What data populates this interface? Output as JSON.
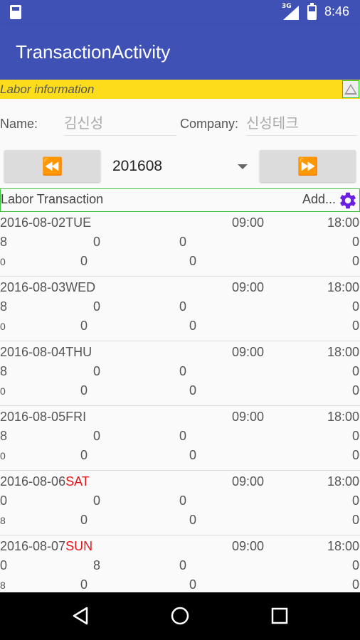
{
  "status_bar": {
    "network": "3G",
    "time": "8:46",
    "icons": [
      "sd-card-icon",
      "signal-icon",
      "battery-charging-icon"
    ]
  },
  "app_bar": {
    "title": "TransactionActivity"
  },
  "labor_info": {
    "section_label": "Labor information",
    "name_label": "Name:",
    "name_value": "김신성",
    "company_label": "Company:",
    "company_value": "신성테크"
  },
  "month_nav": {
    "prev_icon": "rewind-icon",
    "selected_month": "201608",
    "next_icon": "fast-forward-icon"
  },
  "labor_transaction": {
    "label": "Labor Transaction",
    "add_label": "Add...",
    "settings_icon": "gear-icon",
    "accent_color": "#6A1FE0"
  },
  "colors": {
    "primary": "#3F51B5",
    "section_bar": "#FDDC1B",
    "weekend": "#E8141A",
    "border_green": "#3BC23B"
  },
  "rows": [
    {
      "date": "2016-08-02",
      "dow": "TUE",
      "weekend": false,
      "start": "09:00",
      "end": "18:00",
      "l2": [
        "8",
        "0",
        "0",
        "0"
      ],
      "l3": [
        "0",
        "0",
        "0",
        "0"
      ]
    },
    {
      "date": "2016-08-03",
      "dow": "WED",
      "weekend": false,
      "start": "09:00",
      "end": "18:00",
      "l2": [
        "8",
        "0",
        "0",
        "0"
      ],
      "l3": [
        "0",
        "0",
        "0",
        "0"
      ]
    },
    {
      "date": "2016-08-04",
      "dow": "THU",
      "weekend": false,
      "start": "09:00",
      "end": "18:00",
      "l2": [
        "8",
        "0",
        "0",
        "0"
      ],
      "l3": [
        "0",
        "0",
        "0",
        "0"
      ]
    },
    {
      "date": "2016-08-05",
      "dow": "FRI",
      "weekend": false,
      "start": "09:00",
      "end": "18:00",
      "l2": [
        "8",
        "0",
        "0",
        "0"
      ],
      "l3": [
        "0",
        "0",
        "0",
        "0"
      ]
    },
    {
      "date": "2016-08-06",
      "dow": "SAT",
      "weekend": true,
      "start": "09:00",
      "end": "18:00",
      "l2": [
        "0",
        "0",
        "0",
        "0"
      ],
      "l3": [
        "8",
        "0",
        "0",
        "0"
      ]
    },
    {
      "date": "2016-08-07",
      "dow": "SUN",
      "weekend": true,
      "start": "09:00",
      "end": "18:00",
      "l2": [
        "0",
        "8",
        "0",
        "0"
      ],
      "l3": [
        "8",
        "0",
        "0",
        "0"
      ]
    }
  ],
  "nav_bar": {
    "icons": [
      "back-icon",
      "home-icon",
      "recents-icon"
    ]
  }
}
